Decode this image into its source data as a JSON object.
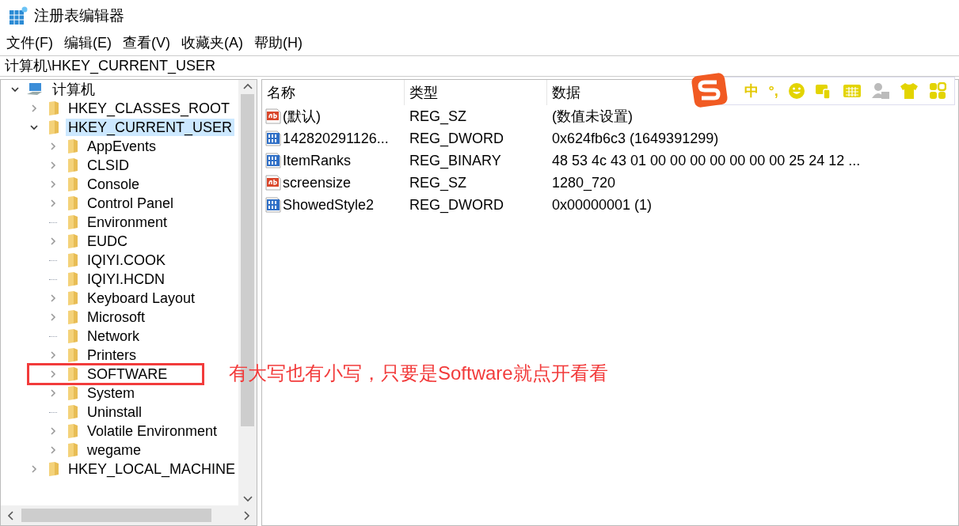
{
  "window": {
    "title": "注册表编辑器"
  },
  "menu": [
    "文件(F)",
    "编辑(E)",
    "查看(V)",
    "收藏夹(A)",
    "帮助(H)"
  ],
  "address": "计算机\\HKEY_CURRENT_USER",
  "tree": {
    "label": "计算机",
    "expanded": true,
    "selected": false,
    "children": [
      {
        "label": "HKEY_CLASSES_ROOT",
        "expandable": true,
        "expanded": false,
        "selected": false
      },
      {
        "label": "HKEY_CURRENT_USER",
        "expandable": true,
        "expanded": true,
        "selected": true,
        "children": [
          {
            "label": "AppEvents",
            "expandable": true,
            "expanded": false,
            "selected": false
          },
          {
            "label": "CLSID",
            "expandable": true,
            "expanded": false,
            "selected": false
          },
          {
            "label": "Console",
            "expandable": true,
            "expanded": false,
            "selected": false
          },
          {
            "label": "Control Panel",
            "expandable": true,
            "expanded": false,
            "selected": false
          },
          {
            "label": "Environment",
            "expandable": false,
            "expanded": false,
            "selected": false
          },
          {
            "label": "EUDC",
            "expandable": true,
            "expanded": false,
            "selected": false
          },
          {
            "label": "IQIYI.COOK",
            "expandable": false,
            "expanded": false,
            "selected": false
          },
          {
            "label": "IQIYI.HCDN",
            "expandable": false,
            "expanded": false,
            "selected": false
          },
          {
            "label": "Keyboard Layout",
            "expandable": true,
            "expanded": false,
            "selected": false
          },
          {
            "label": "Microsoft",
            "expandable": true,
            "expanded": false,
            "selected": false
          },
          {
            "label": "Network",
            "expandable": false,
            "expanded": false,
            "selected": false
          },
          {
            "label": "Printers",
            "expandable": true,
            "expanded": false,
            "selected": false
          },
          {
            "label": "SOFTWARE",
            "expandable": true,
            "expanded": false,
            "selected": false,
            "highlighted": true
          },
          {
            "label": "System",
            "expandable": true,
            "expanded": false,
            "selected": false
          },
          {
            "label": "Uninstall",
            "expandable": false,
            "expanded": false,
            "selected": false
          },
          {
            "label": "Volatile Environment",
            "expandable": true,
            "expanded": false,
            "selected": false
          },
          {
            "label": "wegame",
            "expandable": true,
            "expanded": false,
            "selected": false
          }
        ]
      },
      {
        "label": "HKEY_LOCAL_MACHINE",
        "expandable": true,
        "expanded": false,
        "selected": false
      }
    ]
  },
  "table": {
    "columns": [
      "名称",
      "类型",
      "数据"
    ],
    "rows": [
      {
        "kind": "string",
        "name": "(默认)",
        "type": "REG_SZ",
        "data": "(数值未设置)"
      },
      {
        "kind": "binary",
        "name": "142820291126...",
        "type": "REG_DWORD",
        "data": "0x624fb6c3 (1649391299)"
      },
      {
        "kind": "binary",
        "name": "ItemRanks",
        "type": "REG_BINARY",
        "data": "48 53 4c 43 01 00 00 00 00 00 00 00 25 24 12 ..."
      },
      {
        "kind": "string",
        "name": "screensize",
        "type": "REG_SZ",
        "data": "1280_720"
      },
      {
        "kind": "binary",
        "name": "ShowedStyle2",
        "type": "REG_DWORD",
        "data": "0x00000001 (1)"
      }
    ]
  },
  "ime_toolbar": {
    "items": [
      {
        "kind": "text",
        "label": "中"
      },
      {
        "kind": "text",
        "label": "°,"
      },
      {
        "kind": "smiley"
      },
      {
        "kind": "device"
      },
      {
        "kind": "keyboard"
      },
      {
        "kind": "user"
      },
      {
        "kind": "shirt"
      },
      {
        "kind": "grid"
      }
    ]
  },
  "annotation": {
    "text": "有大写也有小写，只要是Software就点开看看"
  }
}
